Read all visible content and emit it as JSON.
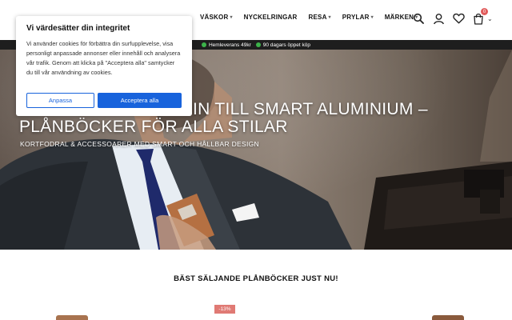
{
  "nav": {
    "items": [
      {
        "label": "VÄSKOR",
        "has_dropdown": true
      },
      {
        "label": "NYCKELRINGAR",
        "has_dropdown": false
      },
      {
        "label": "RESA",
        "has_dropdown": true
      },
      {
        "label": "PRYLAR",
        "has_dropdown": true
      },
      {
        "label": "MÄRKEN",
        "has_dropdown": true
      }
    ],
    "icons": [
      "search-icon",
      "user-icon",
      "heart-icon",
      "cart-icon",
      "chevron-down-icon"
    ],
    "cart_count": "0"
  },
  "promo": {
    "items": [
      "Hemleverans 49kr",
      "90 dagars öppet köp"
    ],
    "dot_color": "#3cb34a"
  },
  "hero": {
    "title_line1": "IN TILL SMART ALUMINIUM –",
    "title_line2": "PLÅNBÖCKER FÖR ALLA STILAR",
    "subtitle": "KORTFODRAL & ACCESSOARER MED SMART OCH HÅLLBAR DESIGN"
  },
  "section": {
    "title": "BÄST SÄLJANDE PLÅNBÖCKER JUST NU!",
    "sale_badge": "-13%"
  },
  "cookie": {
    "heading": "Vi värdesätter din integritet",
    "text": "Vi använder cookies för förbättra din surfupplevelse, visa personligt anpassade annonser eller innehåll och analysera vår trafik. Genom att klicka på \"Acceptera alla\" samtycker du till vår användning av cookies.",
    "customize_label": "Anpassa",
    "accept_label": "Acceptera alla",
    "accent_color": "#1863dc"
  }
}
